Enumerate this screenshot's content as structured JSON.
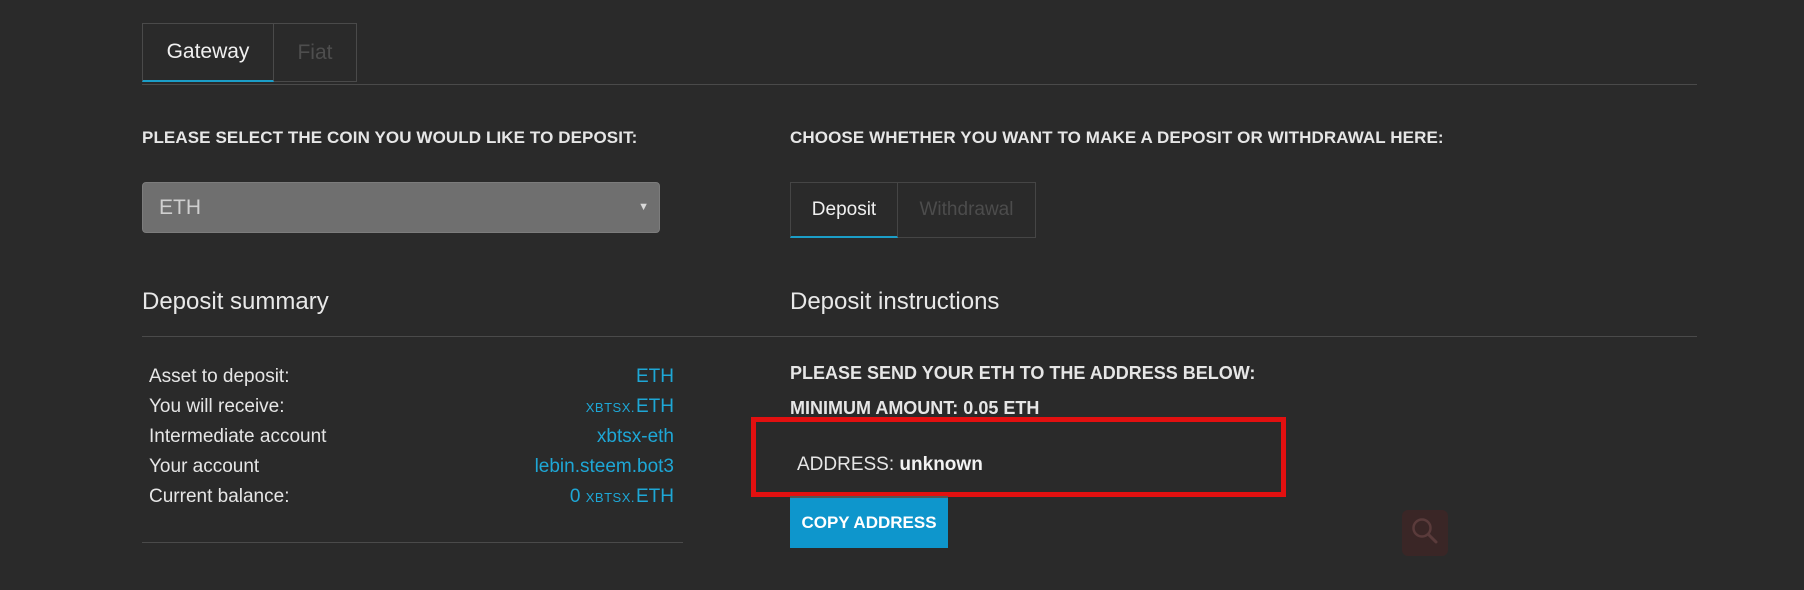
{
  "tabs": {
    "gateway": "Gateway",
    "fiat": "Fiat"
  },
  "select_coin_label": "PLEASE SELECT THE COIN YOU WOULD LIKE TO DEPOSIT:",
  "coin_select": {
    "value": "ETH"
  },
  "choose_label": "CHOOSE WHETHER YOU WANT TO MAKE A DEPOSIT OR WITHDRAWAL HERE:",
  "mode_tabs": {
    "deposit": "Deposit",
    "withdrawal": "Withdrawal"
  },
  "summary": {
    "heading": "Deposit summary",
    "rows": [
      {
        "label": "Asset to deposit:",
        "prefix": "",
        "value": "ETH"
      },
      {
        "label": "You will receive:",
        "prefix": "XBTSX.",
        "value": "ETH"
      },
      {
        "label": "Intermediate account",
        "prefix": "",
        "value": "xbtsx-eth"
      },
      {
        "label": "Your account",
        "prefix": "",
        "value": "lebin.steem.bot3"
      },
      {
        "label": "Current balance:",
        "number": "0",
        "prefix": "XBTSX.",
        "value": "ETH"
      }
    ]
  },
  "instructions": {
    "heading": "Deposit instructions",
    "send_text": "PLEASE SEND YOUR ETH TO THE ADDRESS BELOW:",
    "min_amount": "MINIMUM AMOUNT: 0.05 ETH",
    "address_label": "ADDRESS:",
    "address_value": "unknown",
    "copy_button": "COPY ADDRESS"
  },
  "colors": {
    "background": "#2a2a2a",
    "accent": "#1ea7d6",
    "button": "#0e96cc",
    "highlight_box": "#e21010"
  },
  "icons": {
    "select_caret": "caret-down-icon",
    "fab": "search-icon"
  }
}
